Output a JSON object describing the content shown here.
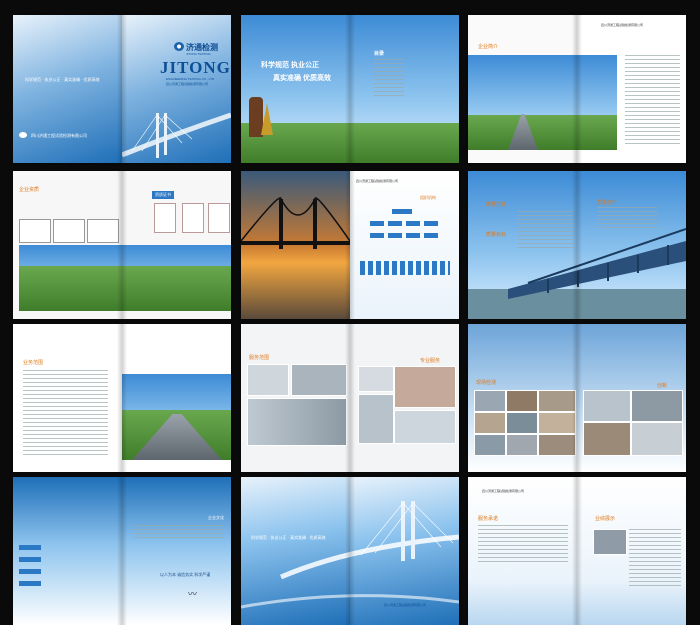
{
  "cover": {
    "logo_cn": "济通检测",
    "logo_en_small": "JITONG TESTING",
    "brand": "JITONG",
    "brand_sub": "ENGINEERING TESTING CO., LTD",
    "company_small": "四川济通工程试验检测有限公司",
    "tagline_left": "科学规范 · 执业公正 · 真实准确 · 优质高效",
    "footer_company": "四川济通工程试验检测有限公司"
  },
  "spread2": {
    "slogan_line1": "科学规范  执业公正",
    "slogan_line2": "真实准确  优质高效",
    "toc_title": "目录"
  },
  "spread3": {
    "heading": "企业简介",
    "header_company": "四川济通工程试验检测有限公司"
  },
  "spread4": {
    "heading": "企业资质",
    "sub_heading": "资质证书"
  },
  "spread5": {
    "heading": "组织机构",
    "header_company": "四川济通工程试验检测有限公司"
  },
  "spread6": {
    "heading_left": "质量方针",
    "heading_right": "质量方针",
    "sub_left": "质量目标"
  },
  "spread7": {
    "heading": "业务范围"
  },
  "spread8": {
    "heading_left": "服务范围",
    "heading_right": "专业服务"
  },
  "spread9": {
    "heading_left": "现场检测",
    "heading_right": "创新"
  },
  "spread10": {
    "right_heading": "企业文化",
    "slogan": "以人为本  诚信务实  科学严谨"
  },
  "spread11": {
    "tagline": "科学规范 · 执业公正 · 真实准确 · 优质高效",
    "footer_company": "四川济通工程试验检测有限公司"
  },
  "spread12": {
    "heading_left": "服务承诺",
    "heading_right": "业绩展示",
    "header_company": "四川济通工程试验检测有限公司"
  },
  "colors": {
    "accent": "#2b78c4",
    "background": "#0a0a0a"
  }
}
